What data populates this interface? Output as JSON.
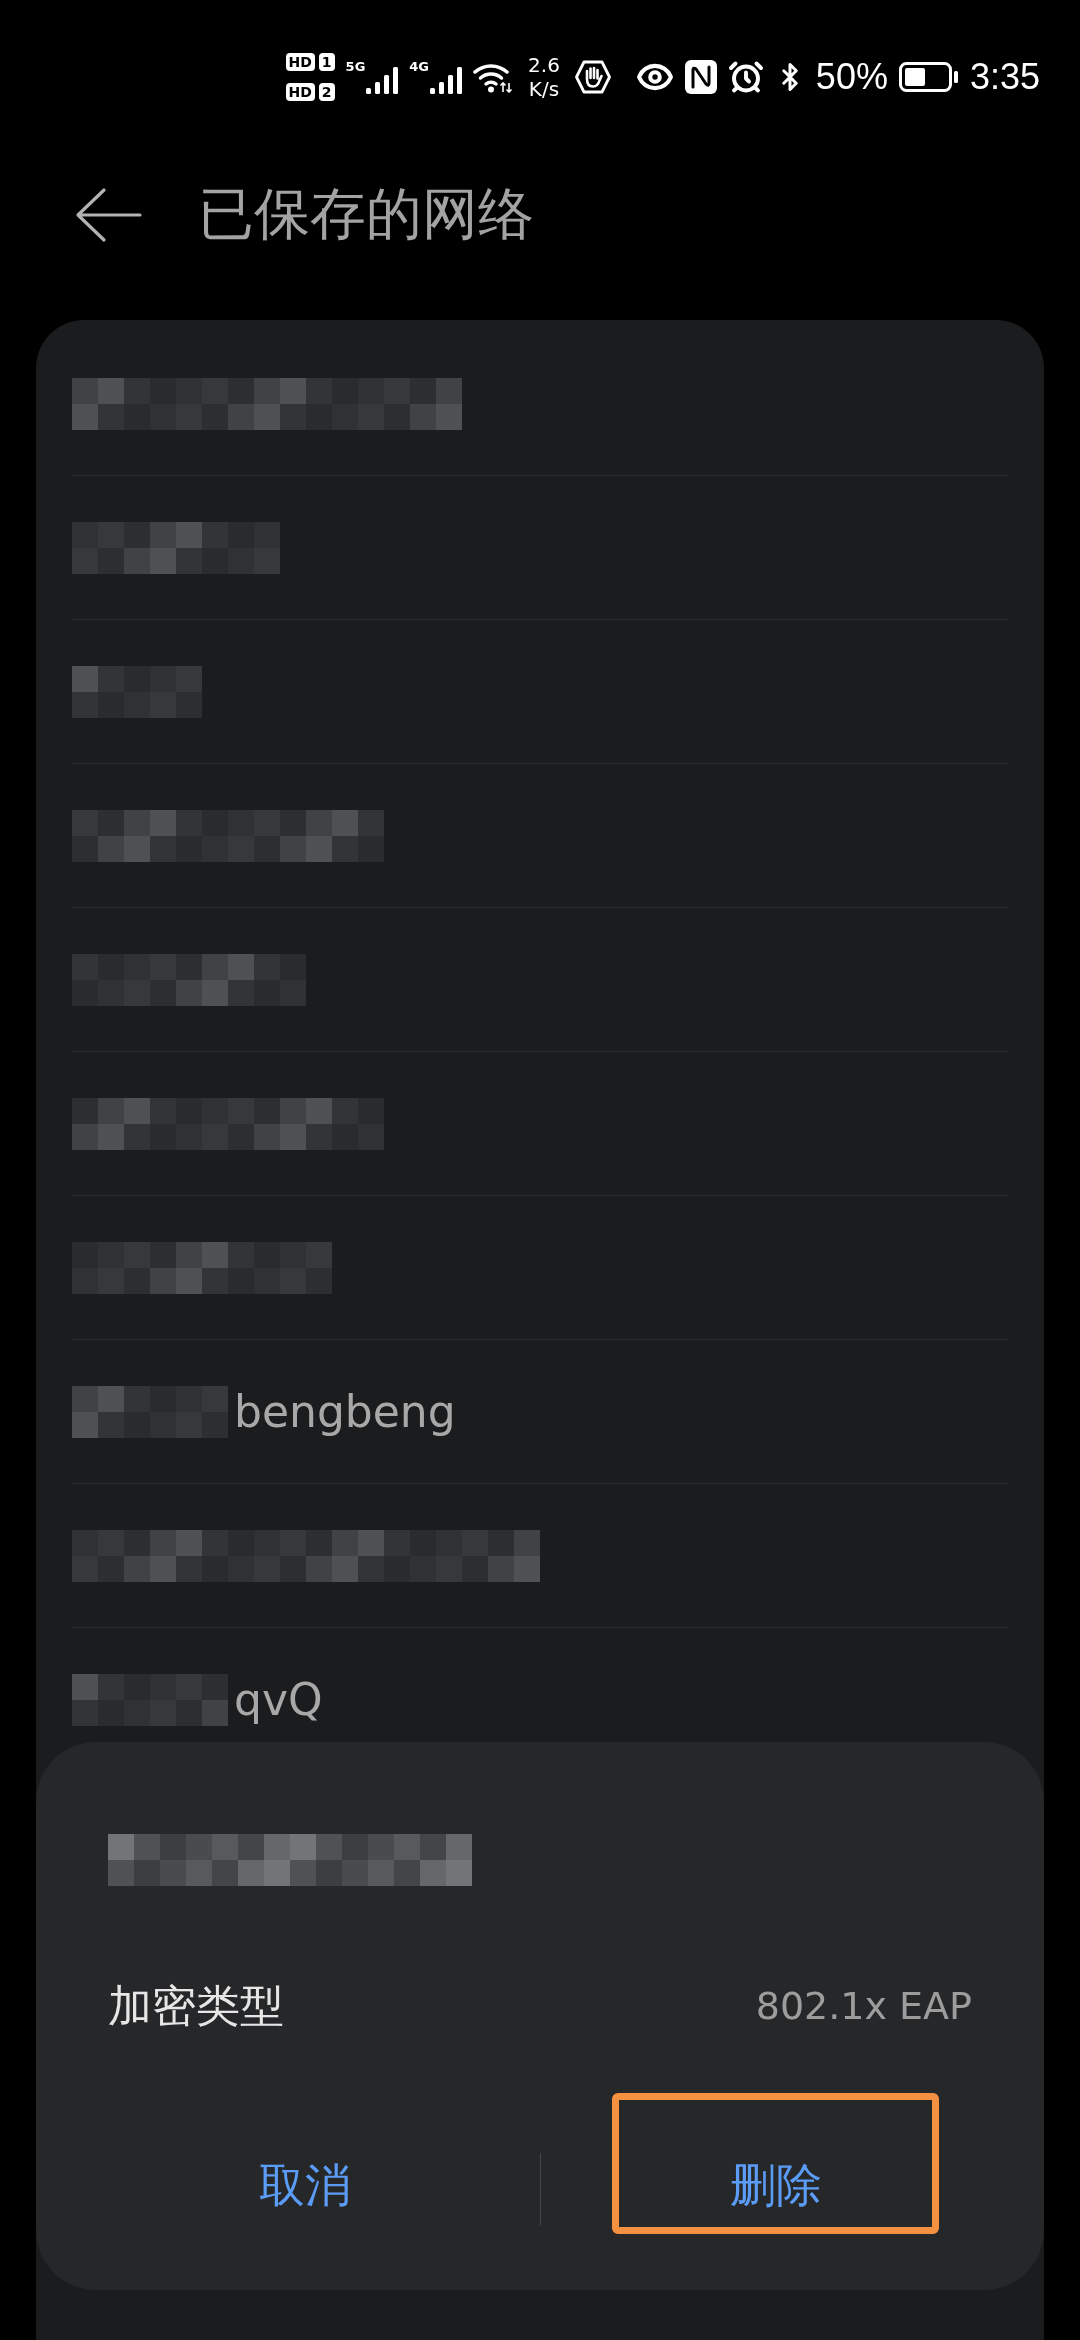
{
  "status_bar": {
    "sim_badges": [
      {
        "label": "HD",
        "slot": "1"
      },
      {
        "label": "HD",
        "slot": "2"
      }
    ],
    "signals": [
      {
        "network": "5G"
      },
      {
        "network": "4G"
      }
    ],
    "net_speed": "2.6",
    "net_speed_unit": "K/s",
    "battery": "50%",
    "time": "3:35"
  },
  "header": {
    "title": "已保存的网络"
  },
  "networks": [
    {
      "redacted": true
    },
    {
      "redacted": true
    },
    {
      "redacted": true
    },
    {
      "redacted": true
    },
    {
      "redacted": true
    },
    {
      "redacted": true
    },
    {
      "redacted": true
    },
    {
      "redacted": true,
      "text": "bengbeng"
    },
    {
      "redacted": true
    },
    {
      "redacted": true,
      "text": "qvQ"
    }
  ],
  "dialog": {
    "title_redacted": true,
    "fields": [
      {
        "label": "加密类型",
        "value": "802.1x EAP"
      }
    ],
    "buttons": [
      {
        "label": "取消",
        "highlighted": false
      },
      {
        "label": "删除",
        "highlighted": true
      }
    ]
  }
}
